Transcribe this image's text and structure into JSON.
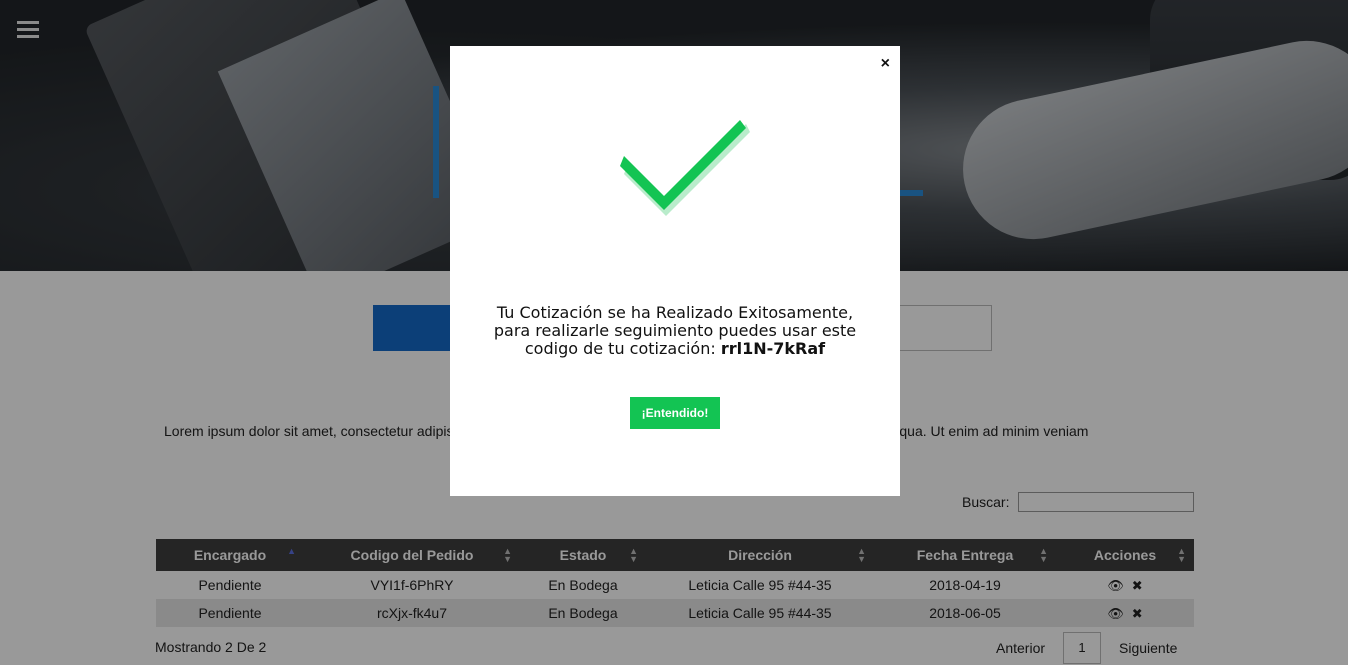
{
  "header": {
    "menu_icon": "hamburger-menu-icon"
  },
  "intro": {
    "text": "Lorem ipsum dolor sit amet, consectetur adipiscing elit, sed do eiusmod tempor incididunt ut labore et dolore magna aliqua. Ut enim ad minim veniam"
  },
  "search": {
    "label": "Buscar:"
  },
  "table": {
    "columns": [
      "Encargado",
      "Codigo del Pedido",
      "Estado",
      "Dirección",
      "Fecha Entrega",
      "Acciones"
    ],
    "rows": [
      {
        "encargado": "Pendiente",
        "codigo": "VYI1f-6PhRY",
        "estado": "En Bodega",
        "direccion": "Leticia Calle 95 #44-35",
        "fecha": "2018-04-19"
      },
      {
        "encargado": "Pendiente",
        "codigo": "rcXjx-fk4u7",
        "estado": "En Bodega",
        "direccion": "Leticia Calle 95 #44-35",
        "fecha": "2018-06-05"
      }
    ],
    "row_actions": {
      "view_icon": "👁",
      "delete_icon": "✖"
    }
  },
  "footer": {
    "showing": "Mostrando 2 De 2",
    "prev": "Anterior",
    "page": "1",
    "next": "Siguiente"
  },
  "modal": {
    "close": "×",
    "line1": "Tu Cotización se ha Realizado Exitosamente,",
    "line2": "para realizarle seguimiento puedes usar este",
    "line3_prefix": "codigo de tu cotización: ",
    "code": "rrl1N-7kRaf",
    "button": "¡Entendido!",
    "colors": {
      "check": "#13c453",
      "check_shadow": "#b9eccb",
      "button": "#13c453"
    }
  }
}
